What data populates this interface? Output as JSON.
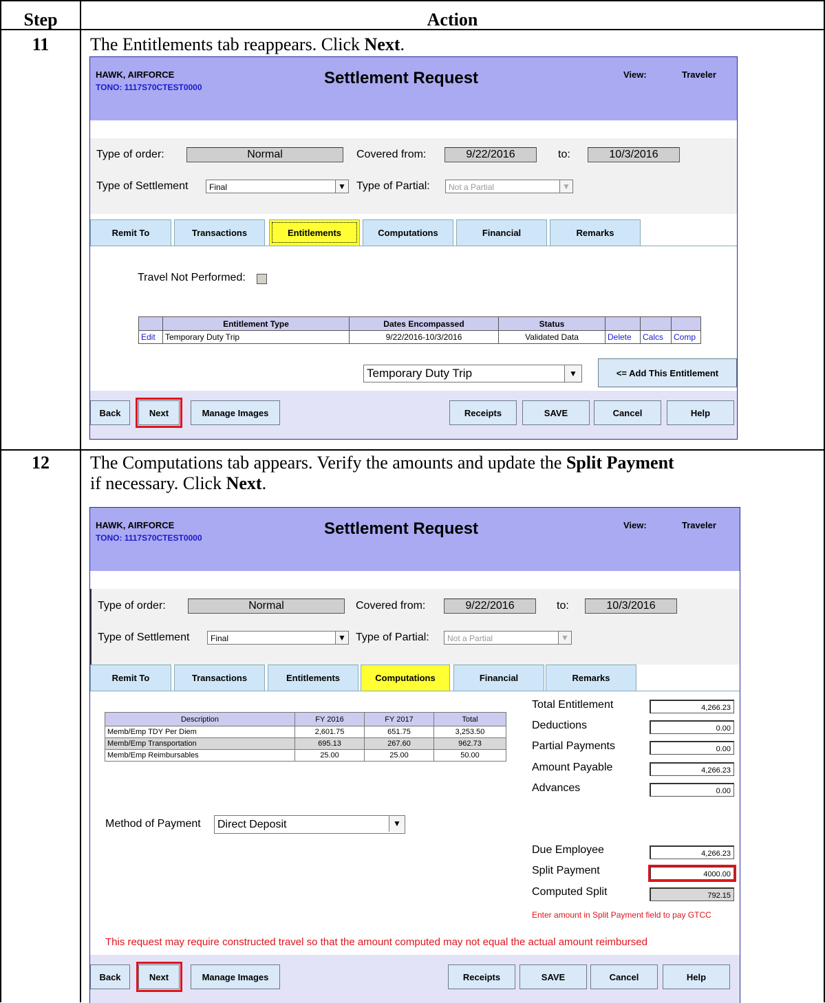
{
  "table": {
    "header_step": "Step",
    "header_action": "Action"
  },
  "steps": [
    {
      "number": "11",
      "text_parts": [
        "The Entitlements tab reappears. Click ",
        "Next",
        "."
      ]
    },
    {
      "number": "12",
      "text_line1": [
        "The Computations tab appears. Verify the amounts and update the ",
        "Split Payment"
      ],
      "text_line2": [
        "if necessary. Click ",
        "Next",
        "."
      ]
    }
  ],
  "screen": {
    "name": "HAWK, AIRFORCE",
    "tono": "TONO: 1117S70CTEST0000",
    "title": "Settlement Request",
    "view_label": "View:",
    "view_value": "Traveler",
    "type_of_order_label": "Type of order:",
    "type_of_order_value": "Normal",
    "covered_from_label": "Covered from:",
    "covered_from_value": "9/22/2016",
    "to_label": "to:",
    "to_value": "10/3/2016",
    "settlement_label": "Type of Settlement",
    "settlement_value": "Final",
    "partial_label": "Type of Partial:",
    "partial_value": "Not a Partial",
    "tabs": [
      "Remit To",
      "Transactions",
      "Entitlements",
      "Computations",
      "Financial",
      "Remarks"
    ],
    "buttons": {
      "back": "Back",
      "next": "Next",
      "manage_images": "Manage Images",
      "receipts": "Receipts",
      "save": "SAVE",
      "cancel": "Cancel",
      "help": "Help"
    }
  },
  "entitlements": {
    "travel_not_performed": "Travel Not Performed:",
    "columns": [
      "",
      "Entitlement Type",
      "Dates Encompassed",
      "Status",
      "",
      "",
      ""
    ],
    "row": {
      "edit": "Edit",
      "type": "Temporary Duty Trip",
      "dates": "9/22/2016-10/3/2016",
      "status": "Validated Data",
      "delete": "Delete",
      "calcs": "Calcs",
      "comp": "Comp"
    },
    "dropdown_value": "Temporary Duty Trip",
    "add_button": "<= Add This Entitlement"
  },
  "computations": {
    "columns": [
      "Description",
      "FY 2016",
      "FY 2017",
      "Total"
    ],
    "rows": [
      [
        "Memb/Emp TDY Per Diem",
        "2,601.75",
        "651.75",
        "3,253.50"
      ],
      [
        "Memb/Emp Transportation",
        "695.13",
        "267.60",
        "962.73"
      ],
      [
        "Memb/Emp Reimbursables",
        "25.00",
        "25.00",
        "50.00"
      ]
    ],
    "summary": [
      {
        "label": "Total Entitlement",
        "value": "4,266.23"
      },
      {
        "label": "Deductions",
        "value": "0.00"
      },
      {
        "label": "Partial Payments",
        "value": "0.00"
      },
      {
        "label": "Amount Payable",
        "value": "4,266.23"
      },
      {
        "label": "Advances",
        "value": "0.00"
      }
    ],
    "method_label": "Method of Payment",
    "method_value": "Direct Deposit",
    "due_employee_label": "Due Employee",
    "due_employee_value": "4,266.23",
    "split_payment_label": "Split Payment",
    "split_payment_value": "4000.00",
    "computed_split_label": "Computed Split",
    "computed_split_value": "792.15",
    "split_note": "Enter amount in Split Payment field to pay GTCC",
    "constructed_note": "This request may require constructed travel so that the amount computed may not equal the actual amount reimbursed"
  }
}
